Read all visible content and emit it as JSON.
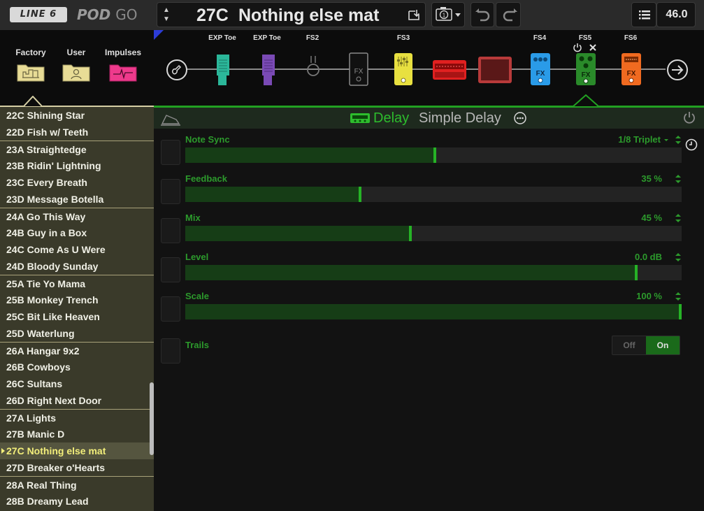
{
  "header": {
    "logo_line6": "LINE 6",
    "logo_pod": "POD",
    "logo_go": "GO",
    "preset_number": "27C",
    "preset_name": "Nothing else mat",
    "tempo": "46.0"
  },
  "browser": {
    "tabs": [
      {
        "label": "Factory",
        "color": "#e8dc96"
      },
      {
        "label": "User",
        "color": "#e8dc96"
      },
      {
        "label": "Impulses",
        "color": "#ee3a8c"
      }
    ],
    "presets": [
      "22C Shining Star",
      "22D Fish w/ Teeth",
      "23A Straightedge",
      "23B Ridin' Lightning",
      "23C Every Breath",
      "23D Message Botella",
      "24A Go This Way",
      "24B Guy in a Box",
      "24C Come As U Were",
      "24D Bloody Sunday",
      "25A Tie Yo Mama",
      "25B Monkey Trench",
      "25C Bit Like Heaven",
      "25D Waterlung",
      "26A Hangar 9x2",
      "26B Cowboys",
      "26C Sultans",
      "26D Right Next Door",
      "27A Lights",
      "27B Manic D",
      "27C Nothing else mat",
      "27D Breaker o'Hearts",
      "28A Real Thing",
      "28B Dreamy Lead"
    ],
    "selected_index": 20
  },
  "chain": {
    "labels": {
      "exp1": "EXP Toe",
      "exp2": "EXP Toe",
      "fs2": "FS2",
      "fs3": "FS3",
      "fs4": "FS4",
      "fs5": "FS5",
      "fs6": "FS6"
    },
    "fx_text": "FX",
    "colors": {
      "wah": "#2bb79a",
      "volume": "#7a4ab5",
      "comp": "#e8e040",
      "amp": "#e02020",
      "cab": "#b83a3a",
      "fx4": "#2a9be8",
      "fx5": "#2a8a2a",
      "fx6": "#f06a20"
    }
  },
  "editor": {
    "type": "Delay",
    "model": "Simple Delay",
    "params": [
      {
        "label": "Note Sync",
        "value": "1/8 Triplet",
        "level": 0.5,
        "dropdown": true
      },
      {
        "label": "Feedback",
        "value": "35 %",
        "level": 0.35
      },
      {
        "label": "Mix",
        "value": "45 %",
        "level": 0.45
      },
      {
        "label": "Level",
        "value": "0.0 dB",
        "level": 0.905
      },
      {
        "label": "Scale",
        "value": "100 %",
        "level": 1.0
      }
    ],
    "trails": {
      "label": "Trails",
      "off": "Off",
      "on": "On",
      "state": "on"
    }
  }
}
